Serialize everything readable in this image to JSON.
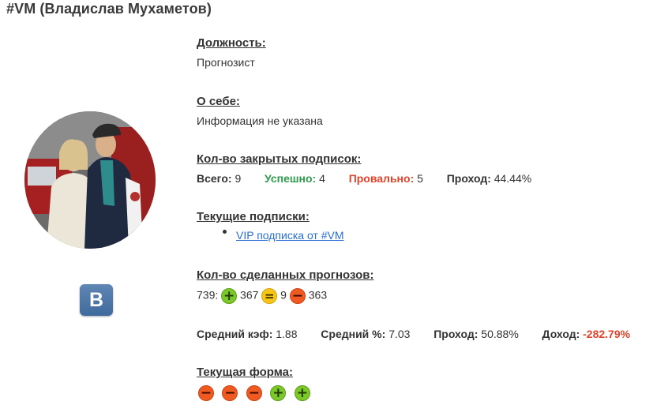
{
  "profile": {
    "title": "#VM (Владислав Мухаметов)",
    "position_label": "Должность:",
    "position_value": "Прогнозист",
    "about_label": "О себе:",
    "about_value": "Информация не указана",
    "vk_label": "B"
  },
  "closed_subs": {
    "label": "Кол-во закрытых подписок:",
    "total_label": "Всего:",
    "total_value": "9",
    "success_label": "Успешно:",
    "success_value": "4",
    "fail_label": "Провально:",
    "fail_value": "5",
    "pass_label": "Проход:",
    "pass_value": "44.44%"
  },
  "current_subs": {
    "label": "Текущие подписки:",
    "items": [
      "VIP подписка от #VM"
    ]
  },
  "forecasts": {
    "label": "Кол-во сделанных прогнозов:",
    "total": "739:",
    "wins": "367",
    "draws": "9",
    "losses": "363"
  },
  "stats": {
    "avg_coef_label": "Средний кэф:",
    "avg_coef_value": "1.88",
    "avg_pct_label": "Средний %:",
    "avg_pct_value": "7.03",
    "pass_label": "Проход:",
    "pass_value": "50.88%",
    "income_label": "Доход:",
    "income_value": "-282.79%"
  },
  "form": {
    "label": "Текущая форма:",
    "results": [
      "loss",
      "loss",
      "loss",
      "win",
      "win"
    ]
  },
  "colors": {
    "success": "#2f9a4c",
    "fail": "#e0442b",
    "link": "#2a6fd6",
    "win_badge": "#7cc72a",
    "draw_badge": "#f6c616",
    "loss_badge": "#ef5a22"
  }
}
